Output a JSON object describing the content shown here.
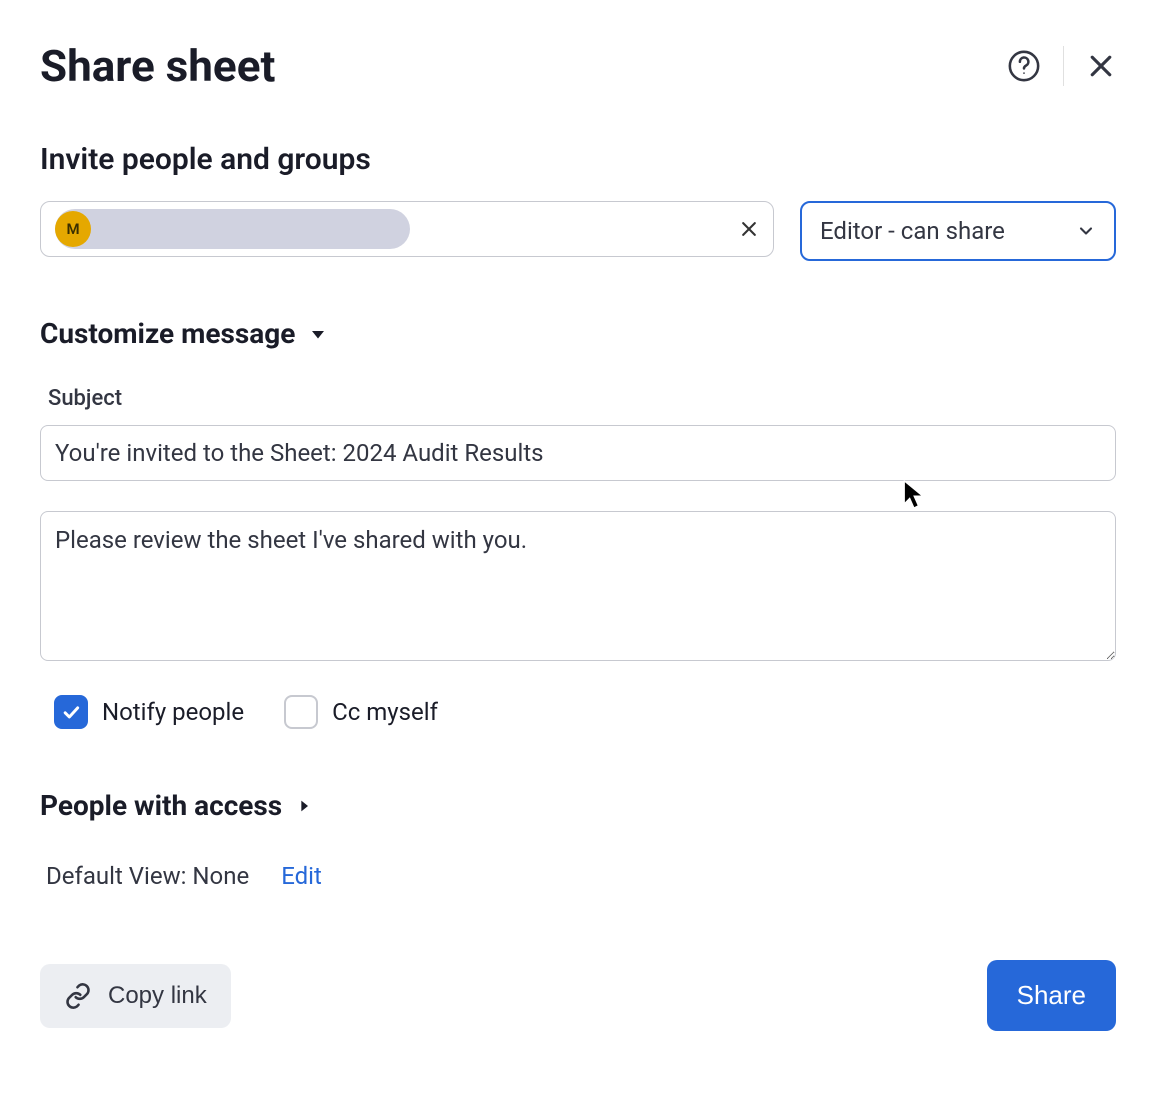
{
  "header": {
    "title": "Share sheet"
  },
  "invite": {
    "heading": "Invite people and groups",
    "avatar_initial": "M",
    "role_selected": "Editor - can share"
  },
  "customize": {
    "heading": "Customize message",
    "subject_label": "Subject",
    "subject_value": "You're invited to the Sheet: 2024 Audit Results",
    "message_value": "Please review the sheet I've shared with you.",
    "notify_label": "Notify people",
    "notify_checked": true,
    "cc_label": "Cc myself",
    "cc_checked": false
  },
  "access": {
    "heading": "People with access",
    "default_view_label": "Default View: None",
    "edit_label": "Edit"
  },
  "footer": {
    "copy_label": "Copy link",
    "share_label": "Share"
  }
}
